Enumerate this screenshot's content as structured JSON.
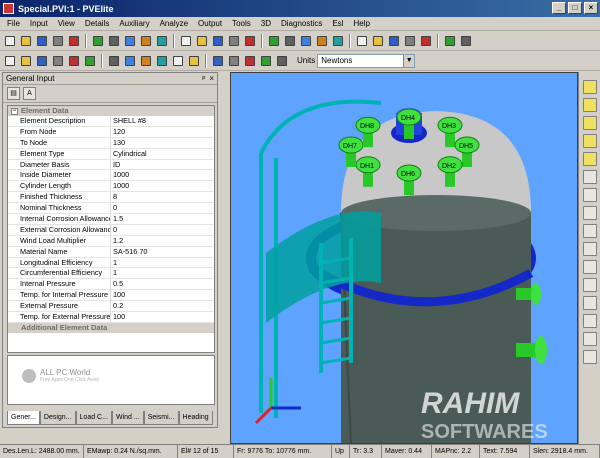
{
  "window": {
    "title": "Special.PVI:1 - PVElite",
    "controls": [
      "_",
      "□",
      "×"
    ]
  },
  "menu": [
    "File",
    "Input",
    "View",
    "Details",
    "Auxiliary",
    "Analyze",
    "Output",
    "Tools",
    "3D",
    "Diagnostics",
    "Esl",
    "Help"
  ],
  "toolbar": {
    "units_label": "Units",
    "units_value": "Newtons",
    "row1_icons": [
      "new-icon",
      "open-icon",
      "save-icon",
      "print-icon",
      "help-icon",
      "shell-icon",
      "head-icon",
      "flange-icon",
      "cone-icon",
      "nozzle-icon",
      "ring-icon",
      "saddle-icon",
      "leg-icon",
      "lug-icon",
      "skirt-icon",
      "basering-icon",
      "weight-icon",
      "insulation-icon",
      "liquid-icon",
      "platform-icon",
      "packing-icon",
      "trayring-icon",
      "clip-icon",
      "halfpipe-icon",
      "jacket-icon",
      "force-icon",
      "analyze-icon"
    ],
    "row2_icons": [
      "detail-icon",
      "edit-icon",
      "delete-icon",
      "insert-icon",
      "split-icon",
      "move-icon",
      "globe-icon",
      "list-icon",
      "report-icon",
      "render-icon",
      "clear-icon",
      "orbit-icon",
      "zoom-icon",
      "pan-icon",
      "walk-icon",
      "check-icon",
      "table-icon"
    ]
  },
  "panel": {
    "title": "General Input",
    "header_buttons": [
      "ᵖ",
      "×"
    ],
    "section_title": "Element Data",
    "additional_title": "Additional Element Data",
    "properties": [
      {
        "key": "Element Description",
        "value": "SHELL #8"
      },
      {
        "key": "From Node",
        "value": "120"
      },
      {
        "key": "To Node",
        "value": "130"
      },
      {
        "key": "Element Type",
        "value": "Cylindrical"
      },
      {
        "key": "Diameter Basis",
        "value": "ID"
      },
      {
        "key": "Inside Diameter",
        "value": "1000"
      },
      {
        "key": "Cylinder Length",
        "value": "1000"
      },
      {
        "key": "Finished Thickness",
        "value": "8"
      },
      {
        "key": "Nominal Thickness",
        "value": "0"
      },
      {
        "key": "Internal Corrosion Allowance",
        "value": "1.5"
      },
      {
        "key": "External Corrosion Allowance",
        "value": "0"
      },
      {
        "key": "Wind Load Multiplier",
        "value": "1.2"
      },
      {
        "key": "Material Name",
        "value": "SA-516 70"
      },
      {
        "key": "Longitudinal Efficiency",
        "value": "1"
      },
      {
        "key": "Circumferential Efficiency",
        "value": "1"
      },
      {
        "key": "Internal Pressure",
        "value": "0.5"
      },
      {
        "key": "Temp. for Internal Pressure",
        "value": "100"
      },
      {
        "key": "External Pressure",
        "value": "0.2"
      },
      {
        "key": "Temp. for External Pressure",
        "value": "100"
      }
    ],
    "tabs": [
      "Gener...",
      "Design...",
      "Load C...",
      "Wind ...",
      "Seismi...",
      "Heading"
    ]
  },
  "watermark": {
    "title": "ALL PC World",
    "subtitle": "Free Apps One Click Away"
  },
  "viewport": {
    "nozzle_labels": [
      "DH4",
      "DH3",
      "DH5",
      "DH2",
      "DH6",
      "DH1",
      "DH7",
      "DH8"
    ],
    "overlay_brand": "RAHIM",
    "overlay_sub": "SOFTWARES",
    "colors": {
      "background": "#5da3ff",
      "vessel": "#4a5a56",
      "head": "#c8c8c8",
      "ladder": "#00b3b3",
      "ring": "#1428c8",
      "nozzle": "#28c828"
    }
  },
  "statusbar": [
    "Des.Len.L: 2488.00 mm.",
    "EMawp: 0.24 N./sq.mm.",
    "El# 12 of 15",
    "Fr: 9776 To: 10776 mm.",
    "Up",
    "Tr: 3.3",
    "Maver: 0.44",
    "MAPnc: 2.2",
    "Text: 7.594",
    "Slen: 2918.4 mm."
  ]
}
